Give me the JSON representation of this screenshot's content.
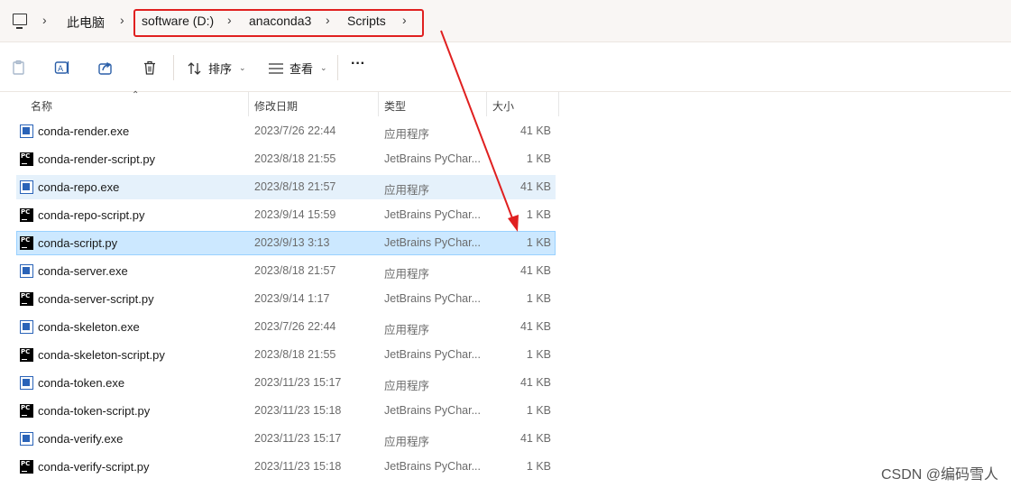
{
  "breadcrumb": {
    "items": [
      "此电脑",
      "software (D:)",
      "anaconda3",
      "Scripts"
    ]
  },
  "toolbar": {
    "sort_label": "排序",
    "view_label": "查看",
    "more_label": "···"
  },
  "columns": {
    "name": "名称",
    "date": "修改日期",
    "type": "类型",
    "size": "大小"
  },
  "files": [
    {
      "name": "conda-render.exe",
      "date": "2023/7/26 22:44",
      "type": "应用程序",
      "size": "41 KB",
      "kind": "exe"
    },
    {
      "name": "conda-render-script.py",
      "date": "2023/8/18 21:55",
      "type": "JetBrains PyChar...",
      "size": "1 KB",
      "kind": "py"
    },
    {
      "name": "conda-repo.exe",
      "date": "2023/8/18 21:57",
      "type": "应用程序",
      "size": "41 KB",
      "kind": "exe"
    },
    {
      "name": "conda-repo-script.py",
      "date": "2023/9/14 15:59",
      "type": "JetBrains PyChar...",
      "size": "1 KB",
      "kind": "py"
    },
    {
      "name": "conda-script.py",
      "date": "2023/9/13 3:13",
      "type": "JetBrains PyChar...",
      "size": "1 KB",
      "kind": "py"
    },
    {
      "name": "conda-server.exe",
      "date": "2023/8/18 21:57",
      "type": "应用程序",
      "size": "41 KB",
      "kind": "exe"
    },
    {
      "name": "conda-server-script.py",
      "date": "2023/9/14 1:17",
      "type": "JetBrains PyChar...",
      "size": "1 KB",
      "kind": "py"
    },
    {
      "name": "conda-skeleton.exe",
      "date": "2023/7/26 22:44",
      "type": "应用程序",
      "size": "41 KB",
      "kind": "exe"
    },
    {
      "name": "conda-skeleton-script.py",
      "date": "2023/8/18 21:55",
      "type": "JetBrains PyChar...",
      "size": "1 KB",
      "kind": "py"
    },
    {
      "name": "conda-token.exe",
      "date": "2023/11/23 15:17",
      "type": "应用程序",
      "size": "41 KB",
      "kind": "exe"
    },
    {
      "name": "conda-token-script.py",
      "date": "2023/11/23 15:18",
      "type": "JetBrains PyChar...",
      "size": "1 KB",
      "kind": "py"
    },
    {
      "name": "conda-verify.exe",
      "date": "2023/11/23 15:17",
      "type": "应用程序",
      "size": "41 KB",
      "kind": "exe"
    },
    {
      "name": "conda-verify-script.py",
      "date": "2023/11/23 15:18",
      "type": "JetBrains PyChar...",
      "size": "1 KB",
      "kind": "py"
    }
  ],
  "watermark": "CSDN @编码雪人",
  "colors": {
    "annotation_red": "#e02020",
    "selected_row": "#cce8ff",
    "hover_row": "#e5f1fb",
    "exe_icon_blue": "#2a63b8"
  }
}
